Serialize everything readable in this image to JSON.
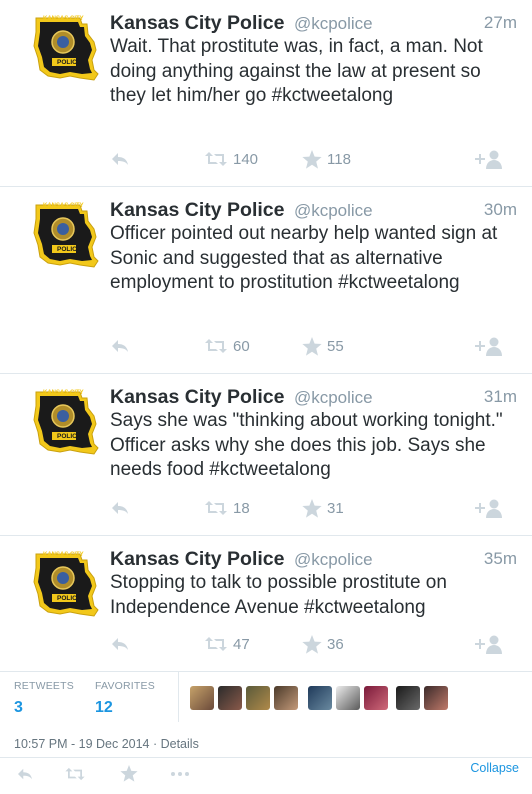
{
  "tweets": [
    {
      "name": "Kansas City Police",
      "handle": "@kcpolice",
      "time": "27m",
      "text": "Wait. That prostitute was, in fact, a man. Not doing anything against the law at present so they let him/her go #kctweetalong",
      "retweets": "140",
      "favorites": "118"
    },
    {
      "name": "Kansas City Police",
      "handle": "@kcpolice",
      "time": "30m",
      "text": "Officer pointed out nearby help wanted sign at Sonic and suggested that as alternative employment to prostitution #kctweetalong",
      "retweets": "60",
      "favorites": "55"
    },
    {
      "name": "Kansas City Police",
      "handle": "@kcpolice",
      "time": "31m",
      "text": "Says she was \"thinking about working tonight.\" Officer asks why she does this job. Says she needs food #kctweetalong",
      "retweets": "18",
      "favorites": "31"
    },
    {
      "name": "Kansas City Police",
      "handle": "@kcpolice",
      "time": "35m",
      "text": "Stopping to talk to possible prostitute on Independence Avenue #kctweetalong",
      "retweets": "47",
      "favorites": "36"
    }
  ],
  "badge": {
    "top_text": "KANSAS CITY",
    "bottom_text": "POLICE"
  },
  "stats": {
    "retweets_label": "RETWEETS",
    "retweets_count": "3",
    "favorites_label": "FAVORITES",
    "favorites_count": "12"
  },
  "footer": {
    "timestamp": "10:57 PM - 19 Dec 2014 · Details",
    "collapse_label": "Collapse"
  },
  "colors": {
    "link_blue": "#1b95e0",
    "muted_gray": "#8899a6",
    "icon_gray": "#ccd6dd",
    "badge_yellow": "#f2c81a",
    "badge_black": "#1a1a1a"
  }
}
